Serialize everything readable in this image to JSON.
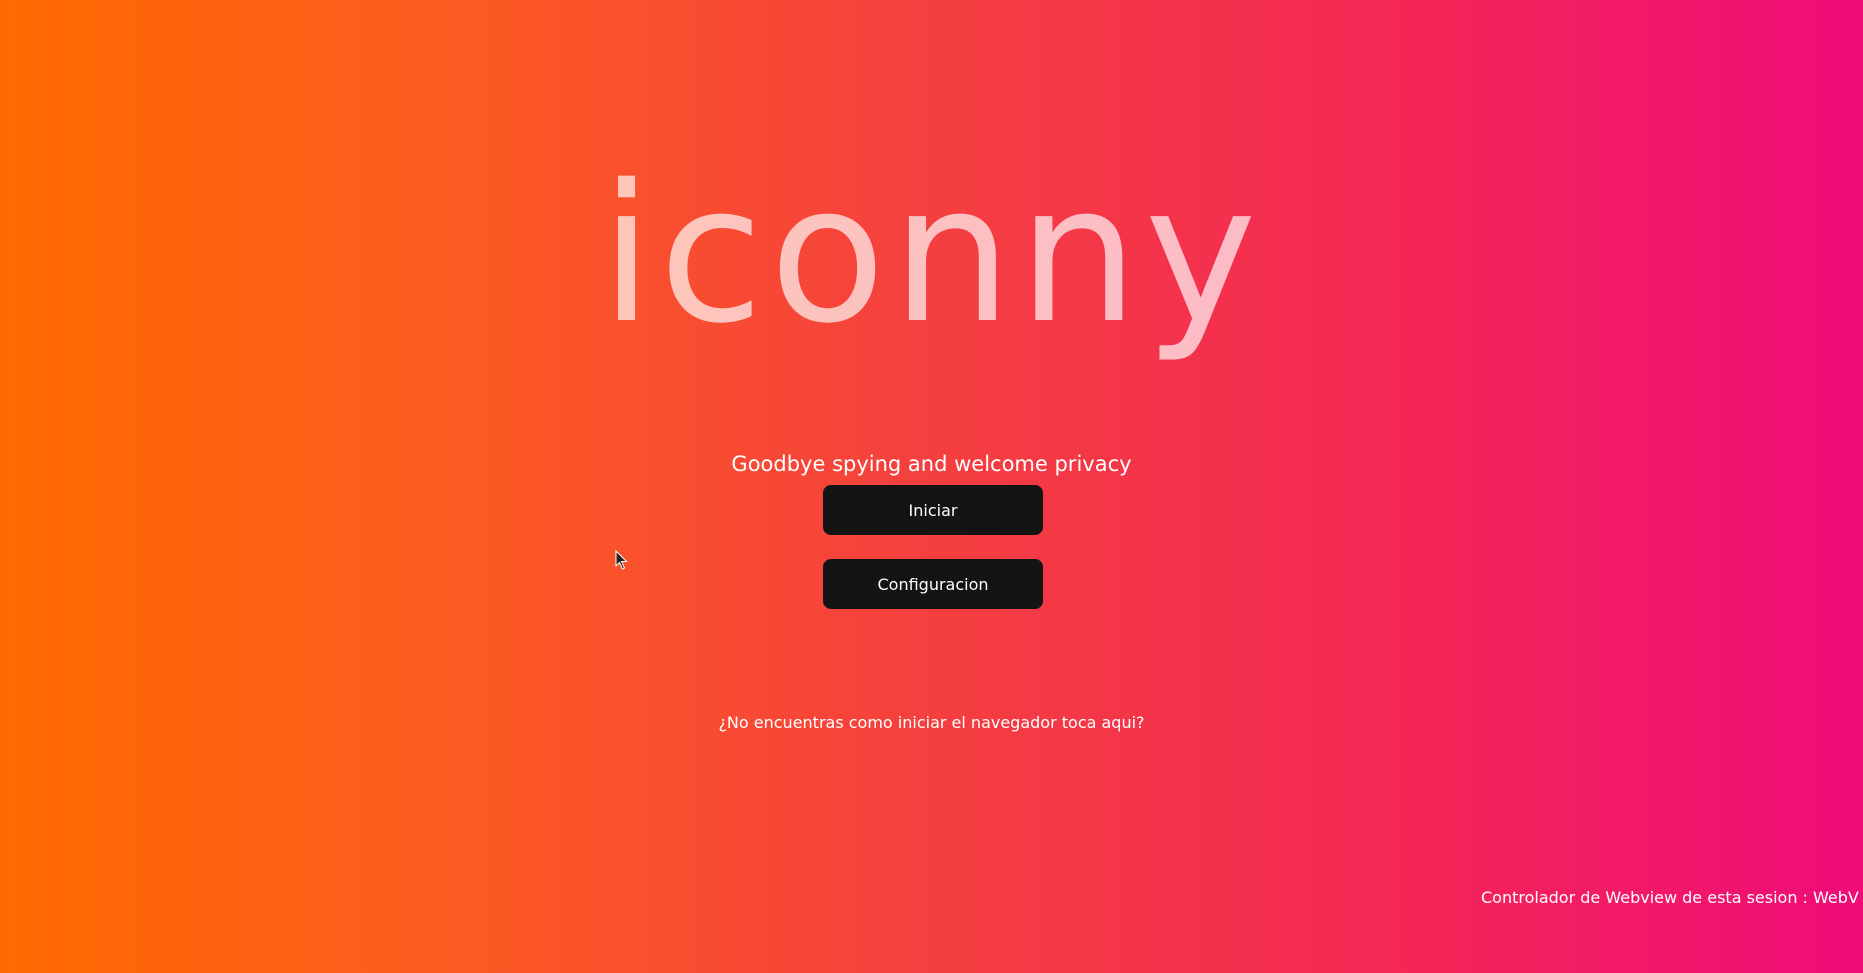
{
  "logo": {
    "text": "iconny"
  },
  "tagline": "Goodbye spying and welcome privacy",
  "buttons": {
    "start_label": "Iniciar",
    "config_label": "Configuracion"
  },
  "help_link": "¿No encuentras como iniciar el navegador toca aqui?",
  "footer": {
    "webview_note": "Controlador de Webview de esta sesion : WebV"
  },
  "colors": {
    "gradient_start": "#ff6a00",
    "gradient_end": "#ef0c79",
    "button_bg": "#141414",
    "text": "#ffffff"
  },
  "icons": {
    "cursor": "mouse-pointer-icon"
  }
}
